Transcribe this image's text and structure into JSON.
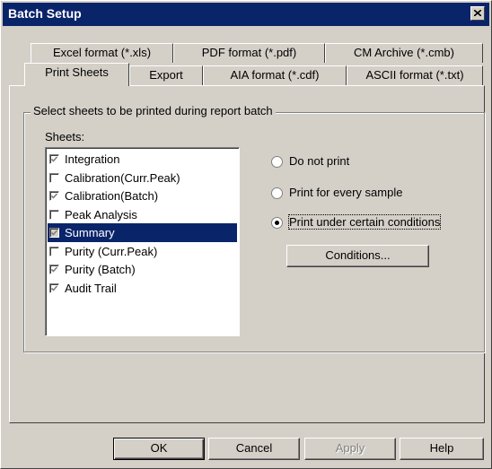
{
  "window": {
    "title": "Batch Setup"
  },
  "tabs_top_row": [
    {
      "label": "Excel format (*.xls)"
    },
    {
      "label": "PDF format (*.pdf)"
    },
    {
      "label": "CM Archive (*.cmb)"
    }
  ],
  "tabs_bottom_row": [
    {
      "label": "Print Sheets",
      "active": true
    },
    {
      "label": "Export"
    },
    {
      "label": "AIA format (*.cdf)"
    },
    {
      "label": "ASCII format (*.txt)"
    }
  ],
  "group": {
    "label": "Select sheets to be printed during report batch"
  },
  "sheets": {
    "label": "Sheets:",
    "items": [
      {
        "label": "Integration",
        "checked": true,
        "selected": false
      },
      {
        "label": "Calibration(Curr.Peak)",
        "checked": false,
        "selected": false
      },
      {
        "label": "Calibration(Batch)",
        "checked": true,
        "selected": false
      },
      {
        "label": "Peak Analysis",
        "checked": false,
        "selected": false
      },
      {
        "label": "Summary",
        "checked": true,
        "selected": true
      },
      {
        "label": "Purity (Curr.Peak)",
        "checked": false,
        "selected": false
      },
      {
        "label": "Purity (Batch)",
        "checked": true,
        "selected": false
      },
      {
        "label": "Audit Trail",
        "checked": true,
        "selected": false
      }
    ]
  },
  "print_options": [
    {
      "label": "Do not print",
      "selected": false
    },
    {
      "label": "Print for every sample",
      "selected": false
    },
    {
      "label": "Print under certain conditions",
      "selected": true
    }
  ],
  "conditions_button": "Conditions...",
  "footer": {
    "ok": "OK",
    "cancel": "Cancel",
    "apply": "Apply",
    "help": "Help"
  }
}
